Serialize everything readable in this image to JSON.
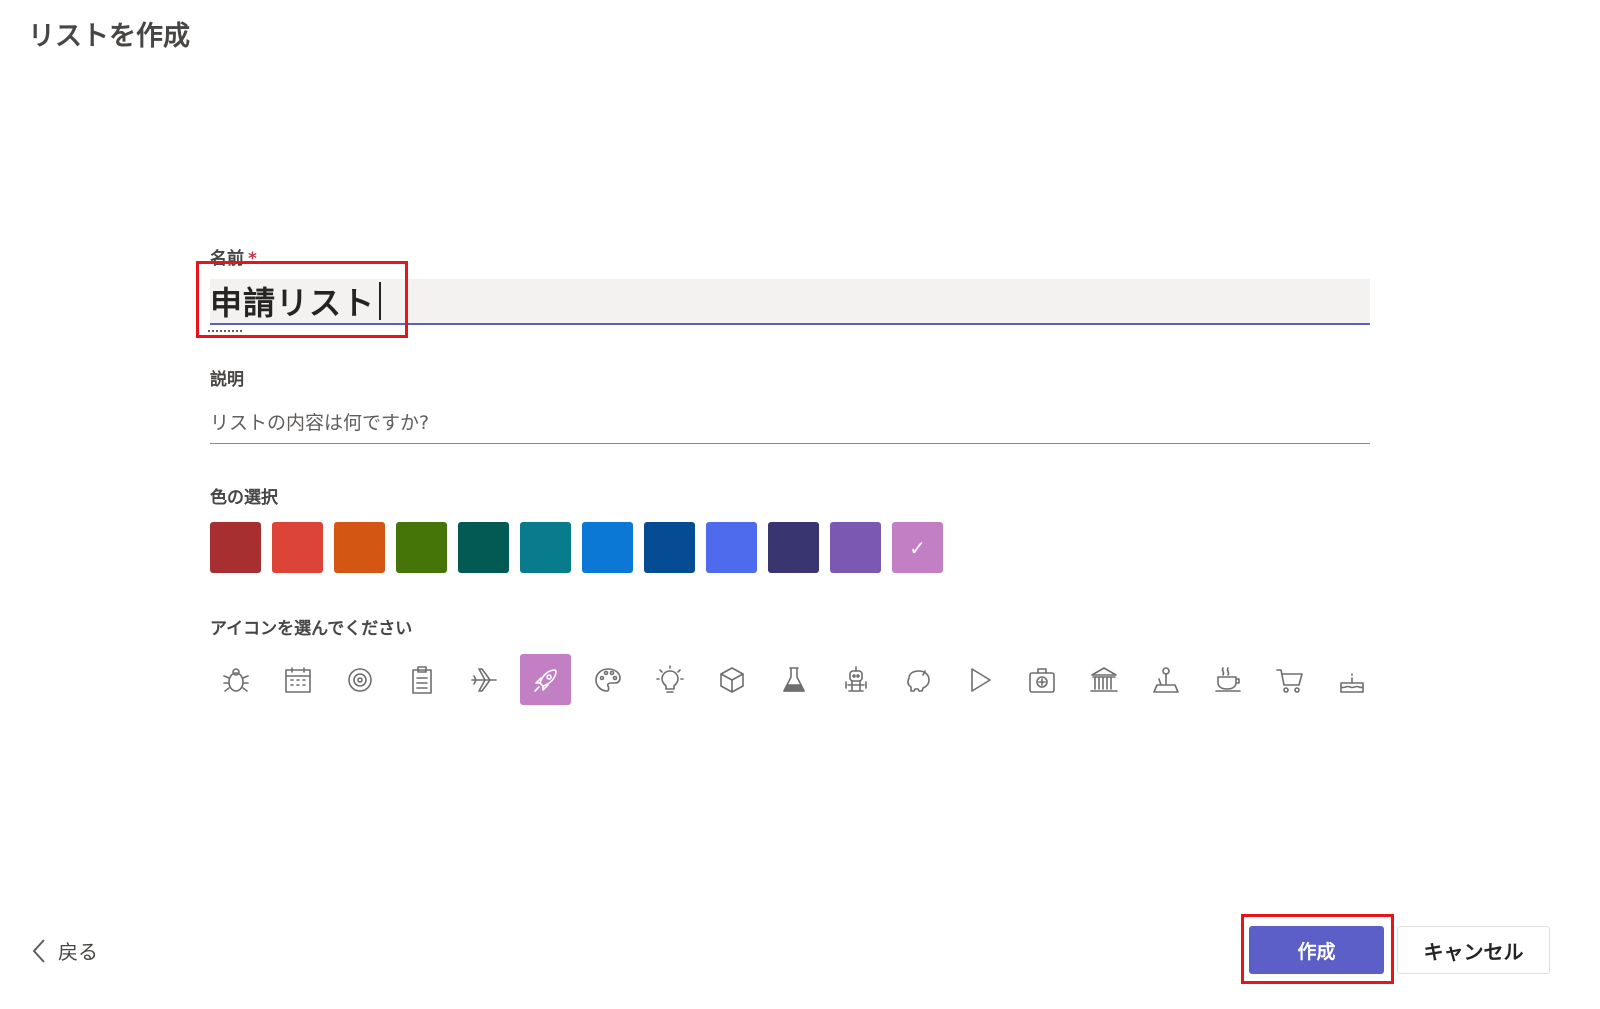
{
  "page": {
    "title": "リストを作成"
  },
  "name_field": {
    "label": "名前",
    "required_mark": "*",
    "value": "申請リスト"
  },
  "description_field": {
    "label": "説明",
    "placeholder": "リストの内容は何ですか?"
  },
  "color_picker": {
    "label": "色の選択",
    "selected_index": 11,
    "check_glyph": "✓",
    "colors": [
      "#a72f2f",
      "#dc4437",
      "#d35712",
      "#457508",
      "#035a54",
      "#087b8c",
      "#0a78d4",
      "#054c94",
      "#4f6bed",
      "#383570",
      "#7b59b3",
      "#c27fc4"
    ]
  },
  "icon_picker": {
    "label": "アイコンを選んでください",
    "selected_index": 5,
    "icons": [
      "bug-icon",
      "calendar-icon",
      "target-icon",
      "clipboard-icon",
      "airplane-icon",
      "rocket-icon",
      "palette-icon",
      "lightbulb-icon",
      "cube-icon",
      "flask-icon",
      "robot-icon",
      "piggy-bank-icon",
      "play-icon",
      "medical-kit-icon",
      "bank-icon",
      "joystick-icon",
      "coffee-cup-icon",
      "shopping-cart-icon",
      "cake-icon"
    ]
  },
  "footer": {
    "back_label": "戻る",
    "create_label": "作成",
    "cancel_label": "キャンセル"
  },
  "colors": {
    "accent": "#5b5fc7",
    "highlight": "#e8141b"
  }
}
